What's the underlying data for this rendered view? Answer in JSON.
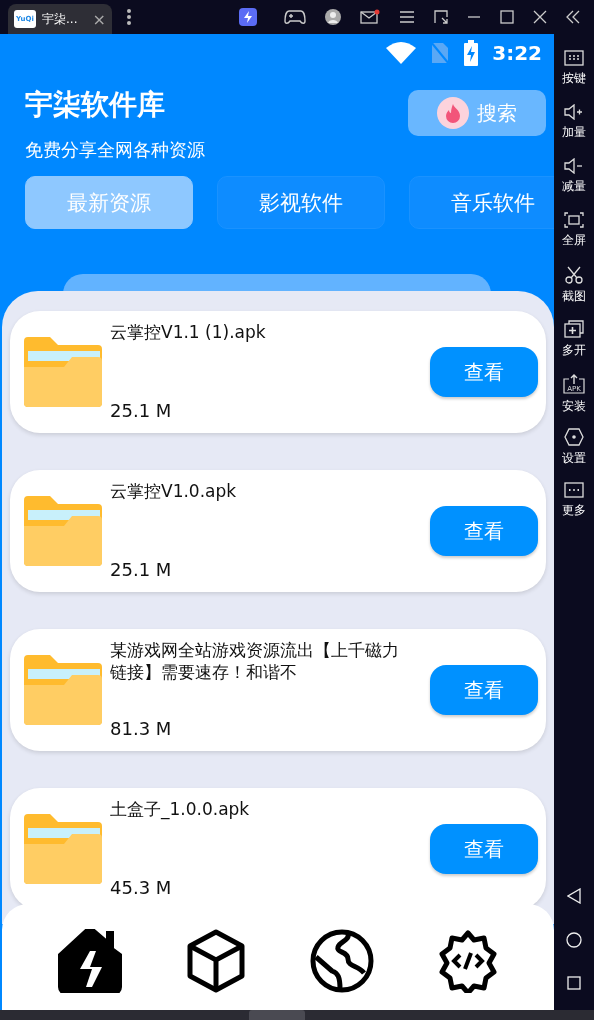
{
  "host_bar": {
    "tab": {
      "logo_text": "YuQi",
      "title": "宇柒...",
      "close": "×"
    }
  },
  "status_bar": {
    "time": "3:22"
  },
  "header": {
    "title": "宇柒软件库",
    "subtitle": "免费分享全网各种资源",
    "search_button": "搜索"
  },
  "tabs": [
    {
      "label": "最新资源",
      "selected": true
    },
    {
      "label": "影视软件",
      "selected": false
    },
    {
      "label": "音乐软件",
      "selected": false
    }
  ],
  "files": [
    {
      "name": "云掌控V1.1 (1).apk",
      "size": "25.1 M",
      "action": "查看"
    },
    {
      "name": "云掌控V1.0.apk",
      "size": "25.1 M",
      "action": "查看"
    },
    {
      "name": "某游戏网全站游戏资源流出【上千磁力链接】需要速存！和谐不",
      "size": "81.3 M",
      "action": "查看"
    },
    {
      "name": "土盒子_1.0.0.apk",
      "size": "45.3 M",
      "action": "查看"
    }
  ],
  "bottom_nav": [
    {
      "kind": "home",
      "selected": true
    },
    {
      "kind": "box",
      "selected": false
    },
    {
      "kind": "globe",
      "selected": false
    },
    {
      "kind": "dev",
      "selected": false
    }
  ],
  "emulator_sidebar": [
    {
      "kind": "keyboard",
      "label": "按键"
    },
    {
      "kind": "vol-up",
      "label": "加量"
    },
    {
      "kind": "vol-down",
      "label": "减量"
    },
    {
      "kind": "fullscreen",
      "label": "全屏"
    },
    {
      "kind": "scissors",
      "label": "截图"
    },
    {
      "kind": "multi",
      "label": "多开"
    },
    {
      "kind": "apk",
      "label": "安装",
      "icon_text": "APK"
    },
    {
      "kind": "settings",
      "label": "设置"
    },
    {
      "kind": "more",
      "label": "更多"
    }
  ]
}
